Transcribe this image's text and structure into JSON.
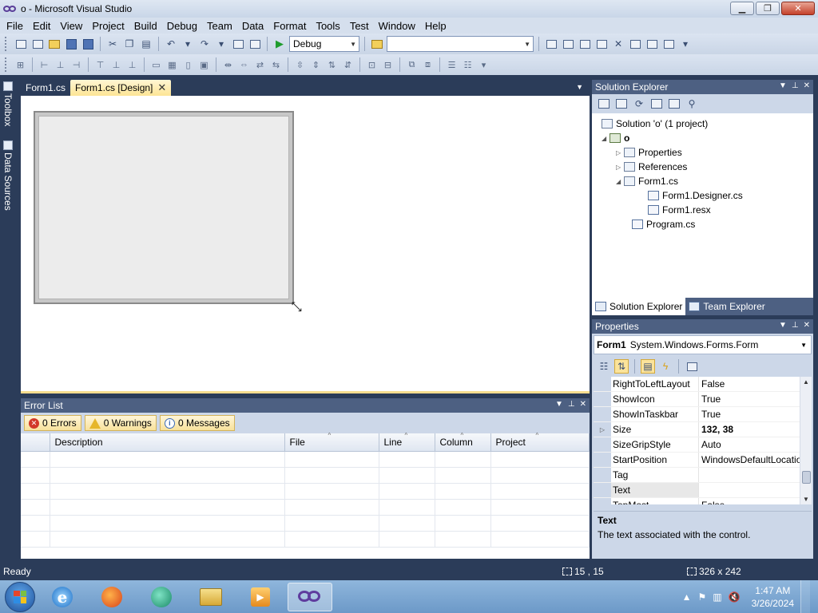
{
  "window": {
    "title": "o - Microsoft Visual Studio",
    "controls": {
      "minimize": "▁",
      "maximize": "❐",
      "close": "✕"
    }
  },
  "menu": [
    "File",
    "Edit",
    "View",
    "Project",
    "Build",
    "Debug",
    "Team",
    "Data",
    "Format",
    "Tools",
    "Test",
    "Window",
    "Help"
  ],
  "toolbar": {
    "configuration": "Debug",
    "platform": ""
  },
  "side_tabs": {
    "toolbox": "Toolbox",
    "data_sources": "Data Sources"
  },
  "doc_tabs": [
    {
      "label": "Form1.cs",
      "active": false
    },
    {
      "label": "Form1.cs [Design]",
      "active": true
    }
  ],
  "designer": {
    "form_size": "326 x 242"
  },
  "error_list": {
    "title": "Error List",
    "filters": {
      "errors": "0 Errors",
      "warnings": "0 Warnings",
      "messages": "0 Messages"
    },
    "columns": [
      "",
      "Description",
      "File",
      "Line",
      "Column",
      "Project"
    ]
  },
  "solution_explorer": {
    "title": "Solution Explorer",
    "tree": [
      {
        "label": "Solution 'o' (1 project)",
        "level": 0,
        "expander": ""
      },
      {
        "label": "o",
        "level": 1,
        "expander": "◢"
      },
      {
        "label": "Properties",
        "level": 2,
        "expander": "▷"
      },
      {
        "label": "References",
        "level": 2,
        "expander": "▷"
      },
      {
        "label": "Form1.cs",
        "level": 2,
        "expander": "◢"
      },
      {
        "label": "Form1.Designer.cs",
        "level": 3,
        "expander": ""
      },
      {
        "label": "Form1.resx",
        "level": 3,
        "expander": ""
      },
      {
        "label": "Program.cs",
        "level": 2,
        "expander": ""
      }
    ],
    "bottom_tabs": [
      "Solution Explorer",
      "Team Explorer"
    ]
  },
  "properties": {
    "title": "Properties",
    "object_name": "Form1",
    "object_type": "System.Windows.Forms.Form",
    "rows": [
      {
        "name": "RightToLeftLayout",
        "value": "False",
        "expandable": false,
        "bold": false
      },
      {
        "name": "ShowIcon",
        "value": "True",
        "expandable": false,
        "bold": false
      },
      {
        "name": "ShowInTaskbar",
        "value": "True",
        "expandable": false,
        "bold": false
      },
      {
        "name": "Size",
        "value": "132, 38",
        "expandable": true,
        "bold": true
      },
      {
        "name": "SizeGripStyle",
        "value": "Auto",
        "expandable": false,
        "bold": false
      },
      {
        "name": "StartPosition",
        "value": "WindowsDefaultLocation",
        "expandable": false,
        "bold": false
      },
      {
        "name": "Tag",
        "value": "",
        "expandable": false,
        "bold": false
      },
      {
        "name": "Text",
        "value": "",
        "expandable": false,
        "bold": false,
        "selected": true
      },
      {
        "name": "TopMost",
        "value": "False",
        "expandable": false,
        "bold": false
      }
    ],
    "description_title": "Text",
    "description": "The text associated with the control."
  },
  "status": {
    "ready": "Ready",
    "position": "15 , 15",
    "size": "326 x 242"
  },
  "taskbar": {
    "time": "1:47 AM",
    "date": "3/26/2024"
  }
}
